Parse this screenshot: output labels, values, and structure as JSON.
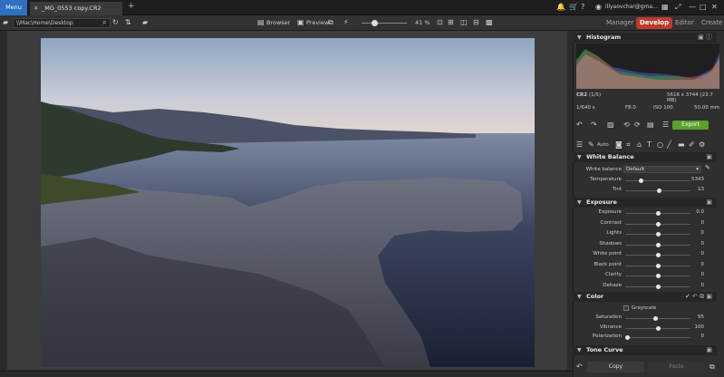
{
  "topbar": {
    "menu_label": "Menu",
    "tab_title": "_MG_0553 copy.CR2",
    "new_tab": "+",
    "username": "illyaovchar@gma..."
  },
  "toolbar": {
    "path": "\\\\Mac\\Home\\Desktop",
    "browser_label": "Browser",
    "preview_label": "Preview",
    "zoom": "41 %"
  },
  "modes": [
    "Manager",
    "Develop",
    "Editor",
    "Create"
  ],
  "panel": {
    "histogram_title": "Histogram",
    "file_type": "CR2",
    "file_index": "(1/5)",
    "dimensions": "5616 x 3744 (23.7 MB)",
    "shutter": "1/640 s",
    "aperture": "F8.0",
    "iso": "ISO 100",
    "focal": "50.00 mm",
    "export_label": "Export",
    "auto_label": "Auto",
    "white_balance": {
      "title": "White Balance",
      "wb_label": "White balance",
      "wb_value": "Default",
      "sliders": [
        {
          "label": "Temperature",
          "value": "5343",
          "pos": 0.24
        },
        {
          "label": "Tint",
          "value": "13",
          "pos": 0.52
        }
      ]
    },
    "exposure": {
      "title": "Exposure",
      "sliders": [
        {
          "label": "Exposure",
          "value": "0.0",
          "pos": 0.5
        },
        {
          "label": "Contrast",
          "value": "0",
          "pos": 0.5
        },
        {
          "label": "Lights",
          "value": "0",
          "pos": 0.5
        },
        {
          "label": "Shadows",
          "value": "0",
          "pos": 0.5
        },
        {
          "label": "White point",
          "value": "0",
          "pos": 0.5
        },
        {
          "label": "Black point",
          "value": "0",
          "pos": 0.5
        },
        {
          "label": "Clarity",
          "value": "0",
          "pos": 0.5
        },
        {
          "label": "Dehaze",
          "value": "0",
          "pos": 0.5
        }
      ]
    },
    "color": {
      "title": "Color",
      "grayscale_label": "Grayscale",
      "sliders": [
        {
          "label": "Saturation",
          "value": "95",
          "pos": 0.47
        },
        {
          "label": "Vibrance",
          "value": "100",
          "pos": 0.5
        },
        {
          "label": "Polarization",
          "value": "0",
          "pos": 0.03
        }
      ]
    },
    "tone_curve_title": "Tone Curve",
    "copy_label": "Copy",
    "paste_label": "Paste"
  }
}
